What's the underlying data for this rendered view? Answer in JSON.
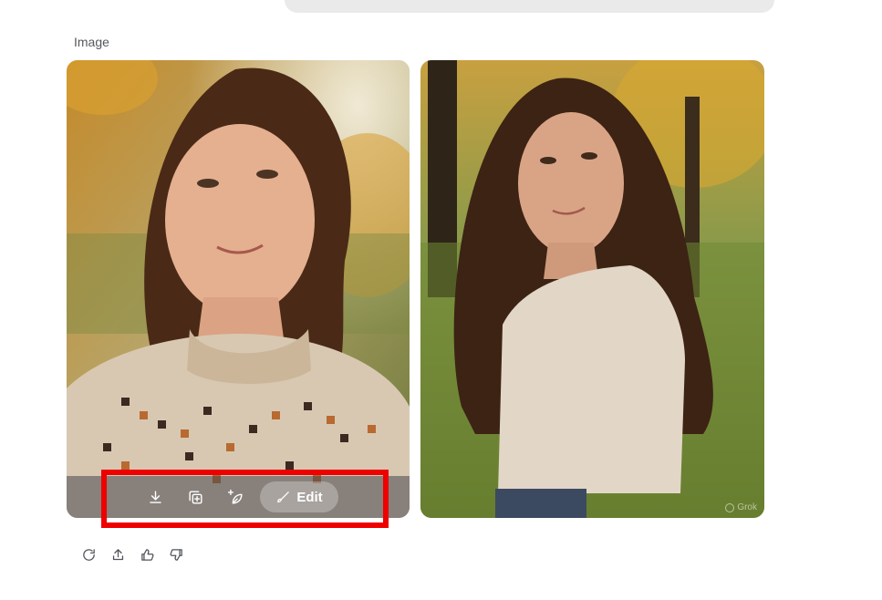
{
  "section": {
    "label": "Image"
  },
  "images": [
    {
      "actions": {
        "download_icon": "download-icon",
        "duplicate_icon": "add-copy-icon",
        "animate_icon": "sparkle-leaf-icon",
        "edit_label": "Edit",
        "edit_icon": "brush-icon"
      }
    },
    {
      "watermark": "Grok"
    }
  ],
  "feedback": {
    "icons": [
      "regenerate-icon",
      "share-icon",
      "thumbs-up-icon",
      "thumbs-down-icon"
    ]
  },
  "colors": {
    "highlight": "#ee0000",
    "action_bar": "#46464e",
    "page_bg": "#ffffff"
  }
}
